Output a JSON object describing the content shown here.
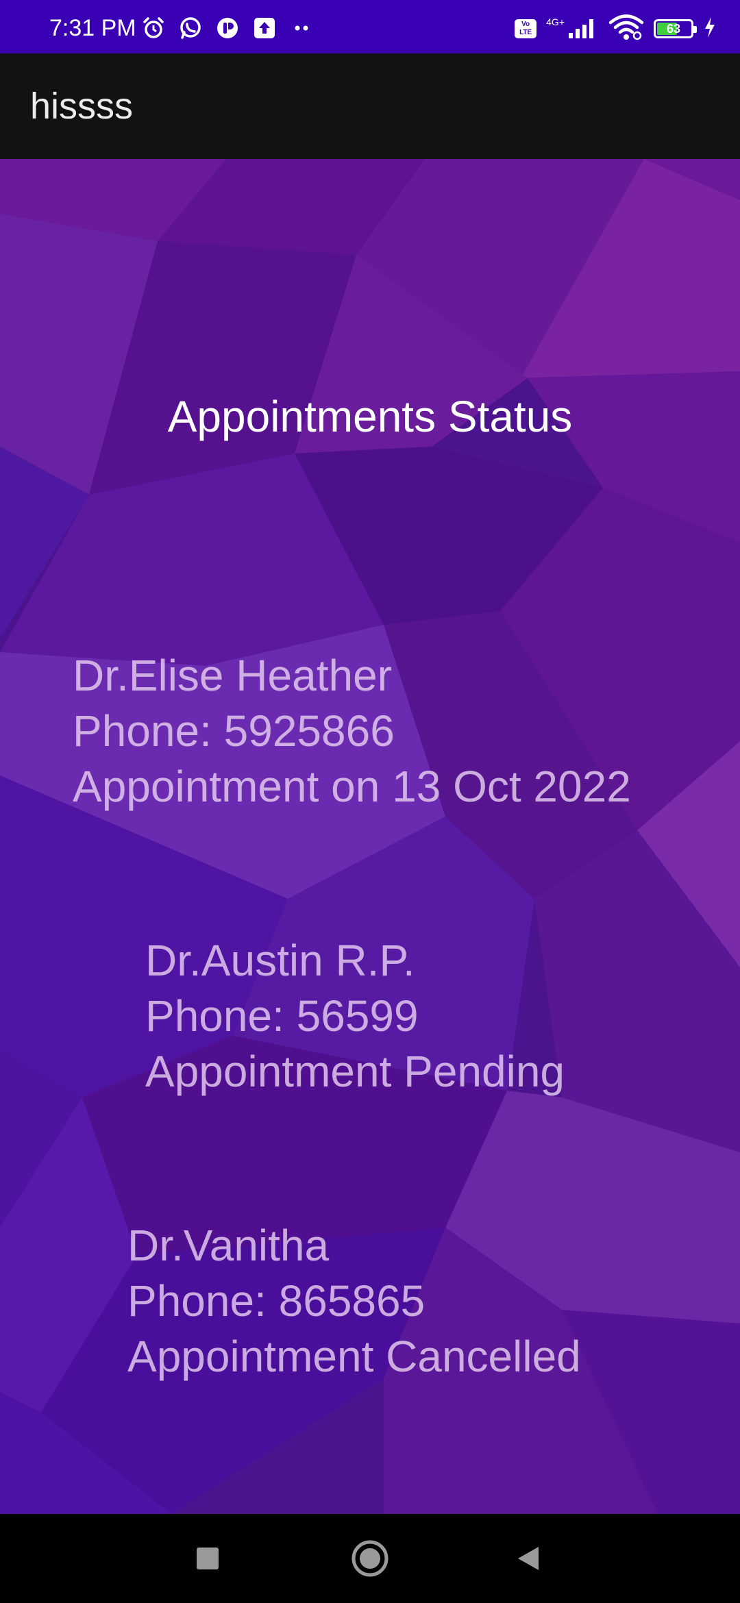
{
  "status_bar": {
    "time": "7:31 PM",
    "network_label": "4G+",
    "volte_label": "Vo LTE",
    "battery_level": 63,
    "battery_text": "63",
    "icons_left": [
      "alarm-icon",
      "whatsapp-icon",
      "app-notification-icon",
      "upload-icon",
      "more-dots-icon"
    ],
    "icons_right": [
      "volte-icon",
      "signal-icon",
      "wifi-icon",
      "battery-icon",
      "charging-icon"
    ]
  },
  "app_bar": {
    "title": "hissss"
  },
  "page": {
    "title": "Appointments Status"
  },
  "appointments": [
    {
      "doctor": "Dr.Elise Heather",
      "phone": "Phone: 5925866",
      "status": "Appointment on 13 Oct 2022"
    },
    {
      "doctor": "Dr.Austin R.P.",
      "phone": "Phone: 56599",
      "status": "Appointment Pending"
    },
    {
      "doctor": "Dr.Vanitha",
      "phone": "Phone: 865865",
      "status": "Appointment Cancelled"
    }
  ],
  "nav_bar": {
    "buttons": [
      "recents-button",
      "home-button",
      "back-button"
    ]
  },
  "colors": {
    "status_bar_bg": "#3a00b4",
    "app_bar_bg": "#121212",
    "background_purple": "#4a1490",
    "appointment_text": "#e6cdf0",
    "battery_fill": "#3fcf3b"
  }
}
